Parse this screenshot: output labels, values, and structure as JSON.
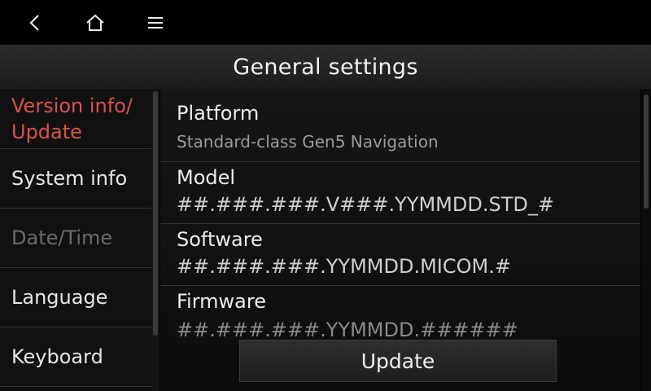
{
  "nav": {
    "back_icon": "chevron-left-icon",
    "home_icon": "home-icon",
    "menu_icon": "hamburger-menu-icon"
  },
  "header": {
    "title": "General settings"
  },
  "sidebar": {
    "items": [
      {
        "line1": "Version info/",
        "line2": "Update",
        "state": "active"
      },
      {
        "label": "System info",
        "state": "normal"
      },
      {
        "label": "Date/Time",
        "state": "disabled"
      },
      {
        "label": "Language",
        "state": "normal"
      },
      {
        "label": "Keyboard",
        "state": "normal"
      }
    ]
  },
  "details": {
    "platform": {
      "label": "Platform",
      "value": "Standard-class Gen5 Navigation"
    },
    "model": {
      "label": "Model",
      "value": "##.###.###.V###.YYMMDD.STD_#"
    },
    "software": {
      "label": "Software",
      "value": "##.###.###.YYMMDD.MICOM.#"
    },
    "firmware": {
      "label": "Firmware",
      "value": "##.###.###.YYMMDD.######"
    }
  },
  "actions": {
    "update_label": "Update"
  },
  "colors": {
    "active": "#d9534a",
    "disabled": "#6a6a6a",
    "background": "#000000"
  }
}
